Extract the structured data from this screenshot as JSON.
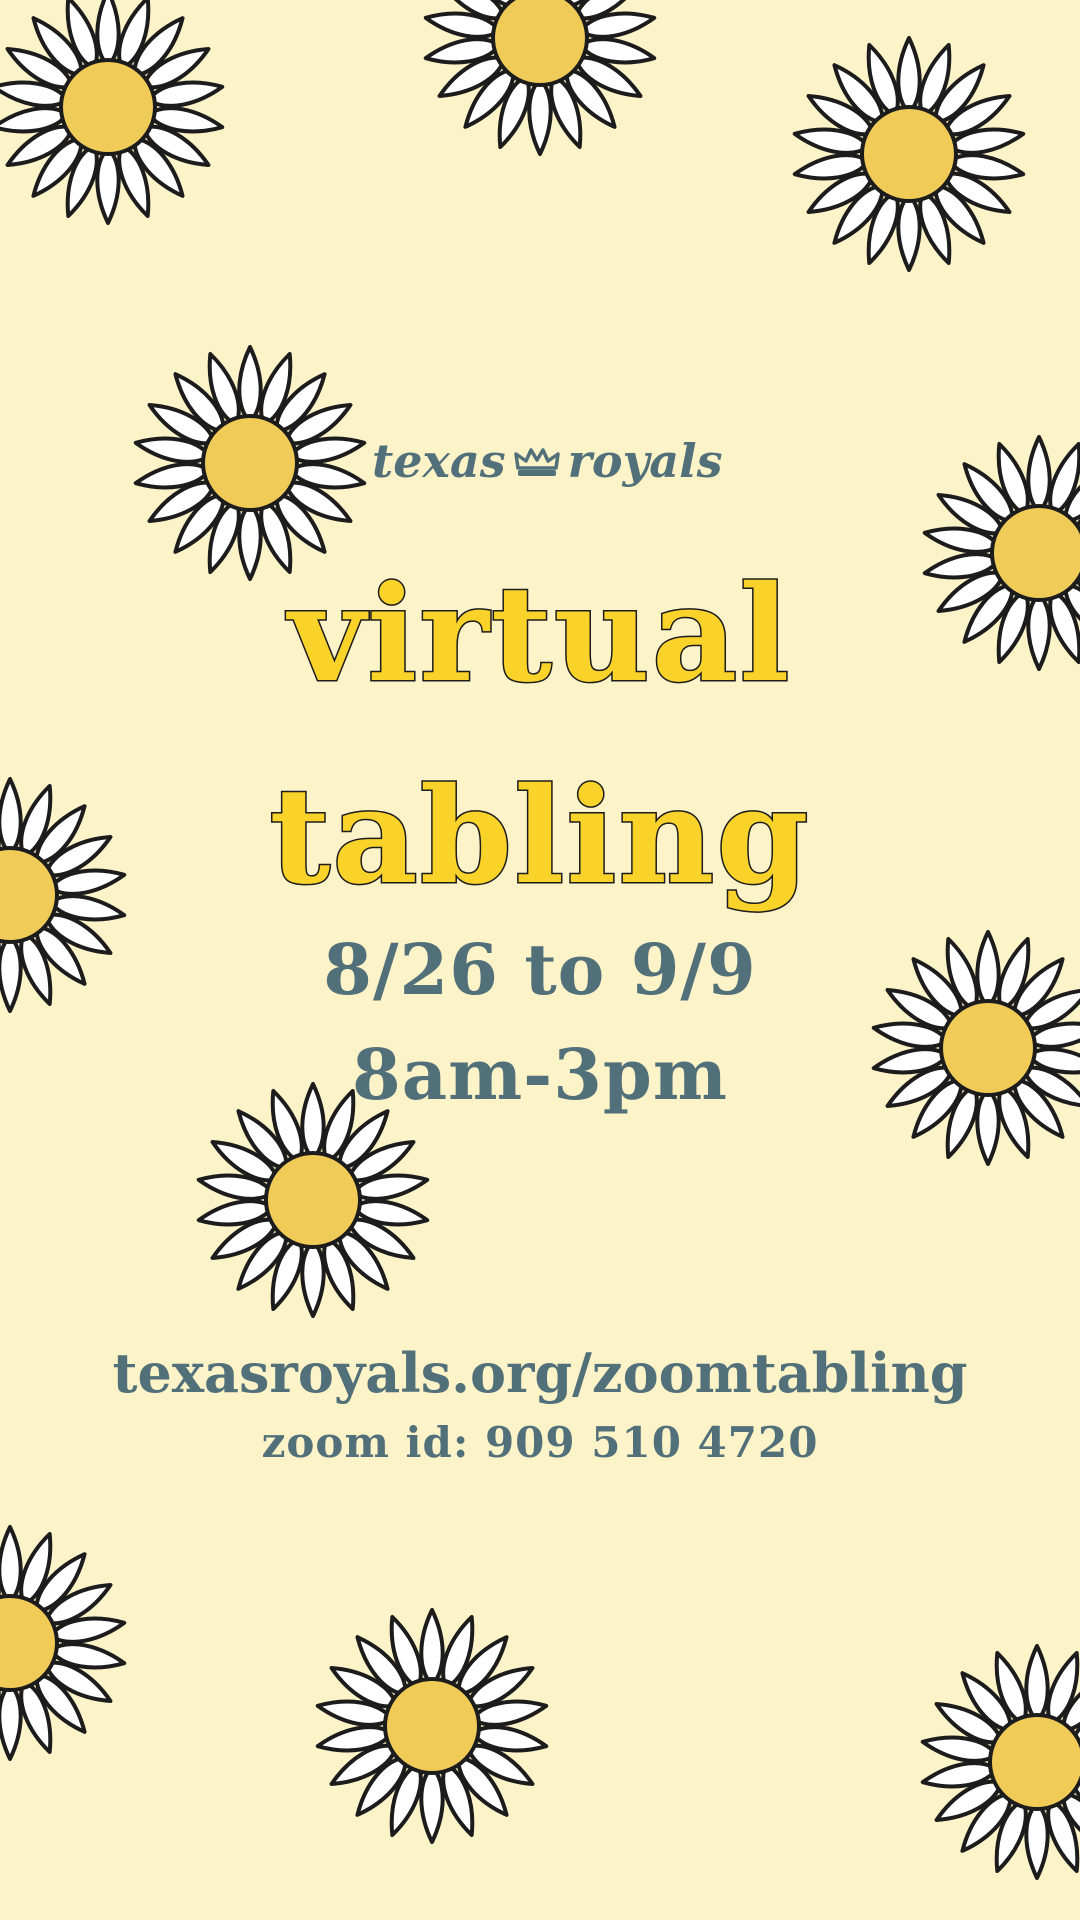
{
  "colors": {
    "background": "#fdf3c9",
    "headline": "#f9d22a",
    "text": "#527079",
    "petal": "#ffffff",
    "flower_center": "#f0cb58",
    "outline": "#1c1c1c"
  },
  "icons": [
    "daisy-icon",
    "crown-icon"
  ],
  "brand": {
    "left_word": "texas",
    "right_word": "royals"
  },
  "headline": {
    "line1": "virtual",
    "line2": "tabling"
  },
  "schedule": {
    "dates": "8/26 to 9/9",
    "hours": "8am-3pm"
  },
  "contact": {
    "url": "texasroyals.org/zoomtabling",
    "zoom_id": "zoom id: 909 510 4720"
  }
}
